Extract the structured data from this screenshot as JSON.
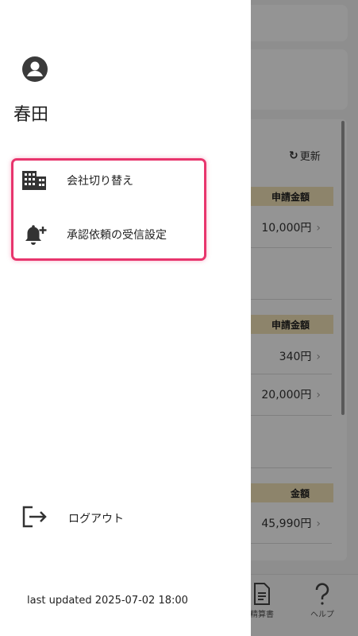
{
  "drawer": {
    "user_name": "春田",
    "menu": [
      {
        "label": "会社切り替え",
        "icon": "building-icon"
      },
      {
        "label": "承認依頼の受信設定",
        "icon": "bell-plus-icon"
      }
    ],
    "logout_label": "ログアウト",
    "last_updated": "last updated 2025-07-02 18:00",
    "highlight_color": "#e8356d"
  },
  "background": {
    "refresh_label": "更新",
    "sections": [
      {
        "header": "申請金額",
        "amounts": [
          "10,000円"
        ]
      },
      {
        "header": "申請金額",
        "amounts": [
          "340円",
          "20,000円"
        ]
      },
      {
        "header": "金額",
        "amounts": [
          "45,990円"
        ]
      }
    ],
    "nav": [
      {
        "label": "精算書",
        "icon": "document-icon"
      },
      {
        "label": "ヘルプ",
        "icon": "help-icon"
      }
    ],
    "header_color": "#f3e3b8"
  }
}
